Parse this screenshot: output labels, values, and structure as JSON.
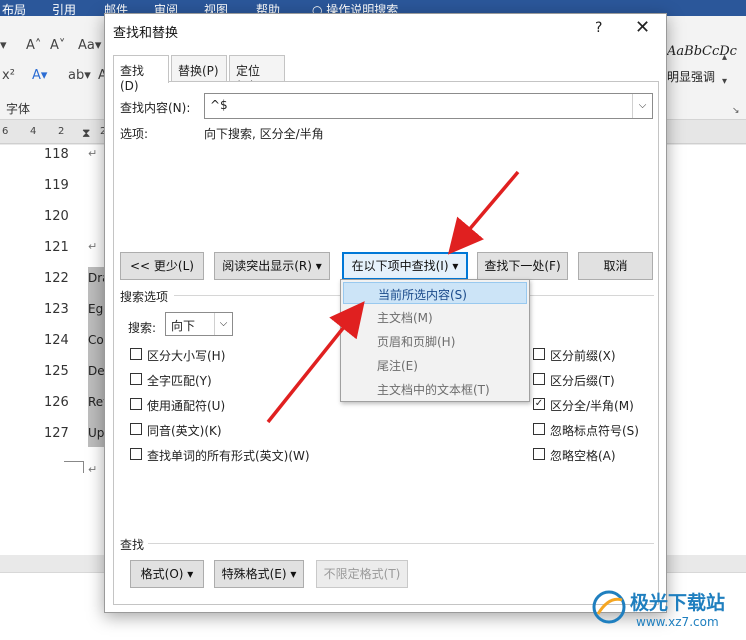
{
  "ribbon": {
    "tabs": [
      "布局",
      "引用",
      "邮件",
      "审阅",
      "视图",
      "帮助",
      "操作说明搜索"
    ],
    "font_group_label": "字体",
    "style_preview": "AaBbCcDc",
    "style_name": "明显强调"
  },
  "ruler": [
    "6",
    "4",
    "2",
    "2"
  ],
  "document": {
    "line_numbers": [
      "118",
      "119",
      "120",
      "121",
      "122",
      "123",
      "124",
      "125",
      "126",
      "127"
    ],
    "highlighted_text": [
      "Dra",
      "Ego",
      "Co",
      "De",
      "Rev",
      "Up"
    ],
    "para_mark": "↵"
  },
  "dialog": {
    "title": "查找和替换",
    "help": "?",
    "close": "✕",
    "tabs": [
      "查找(D)",
      "替换(P)",
      "定位(G)"
    ],
    "find_label": "查找内容(N):",
    "find_value": "^$",
    "options_label": "选项:",
    "options_value": "向下搜索, 区分全/半角",
    "buttons": {
      "less": "<< 更少(L)",
      "reading_highlight": "阅读突出显示(R) ▾",
      "find_in": "在以下项中查找(I) ▾",
      "find_next": "查找下一处(F)",
      "cancel": "取消"
    },
    "search_options_title": "搜索选项",
    "search_label": "搜索:",
    "search_value": "向下",
    "checkboxes_left": [
      {
        "label": "区分大小写(H)",
        "checked": false
      },
      {
        "label": "全字匹配(Y)",
        "checked": false
      },
      {
        "label": "使用通配符(U)",
        "checked": false
      },
      {
        "label": "同音(英文)(K)",
        "checked": false
      },
      {
        "label": "查找单词的所有形式(英文)(W)",
        "checked": false
      }
    ],
    "checkboxes_right": [
      {
        "label": "区分前缀(X)",
        "checked": false
      },
      {
        "label": "区分后缀(T)",
        "checked": false
      },
      {
        "label": "区分全/半角(M)",
        "checked": true
      },
      {
        "label": "忽略标点符号(S)",
        "checked": false
      },
      {
        "label": "忽略空格(A)",
        "checked": false
      }
    ],
    "find_section_title": "查找",
    "bottom_buttons": {
      "format": "格式(O) ▾",
      "special": "特殊格式(E) ▾",
      "no_format": "不限定格式(T)"
    }
  },
  "dropdown_menu": {
    "items": [
      "当前所选内容(S)",
      "主文档(M)",
      "页眉和页脚(H)",
      "尾注(E)",
      "主文档中的文本框(T)"
    ],
    "selected_index": 0
  },
  "watermark": {
    "title": "极光下载站",
    "url": "www.xz7.com"
  },
  "colors": {
    "arrow": "#e02020",
    "ribbon": "#2b579a",
    "selection": "#cce4f7",
    "primary_border": "#0078d7"
  }
}
